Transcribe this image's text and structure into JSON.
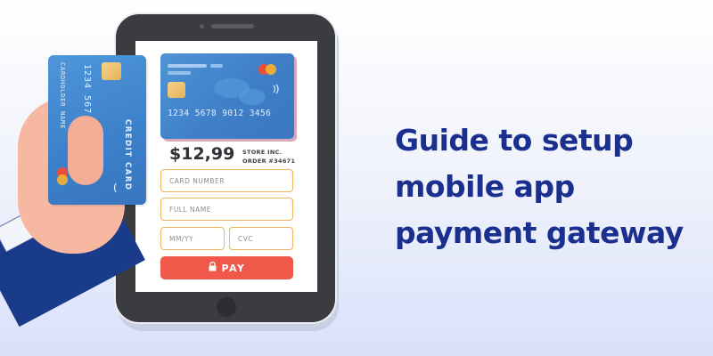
{
  "headline": {
    "line1": "Guide to setup",
    "line2": "mobile app",
    "line3": "payment gateway"
  },
  "screen_card": {
    "number": "1234 5678 9012 3456"
  },
  "checkout": {
    "price": "$12,99",
    "store_name": "STORE INC.",
    "order": "ORDER #34671",
    "card_number_placeholder": "CARD NUMBER",
    "full_name_placeholder": "FULL NAME",
    "expiry_placeholder": "MM/YY",
    "cvc_placeholder": "CVC",
    "pay_label": "PAY"
  },
  "held_card": {
    "number": "1234 567",
    "holder": "CARDHOLDER NAME",
    "type": "CREDIT CARD"
  },
  "colors": {
    "headline": "#1b2f8f",
    "accent_orange": "#f0b35a",
    "pay_red": "#f0584a",
    "card_blue": "#3f7fc8"
  },
  "icons": [
    "lock-icon",
    "contactless-icon",
    "mastercard-logo-icon"
  ]
}
